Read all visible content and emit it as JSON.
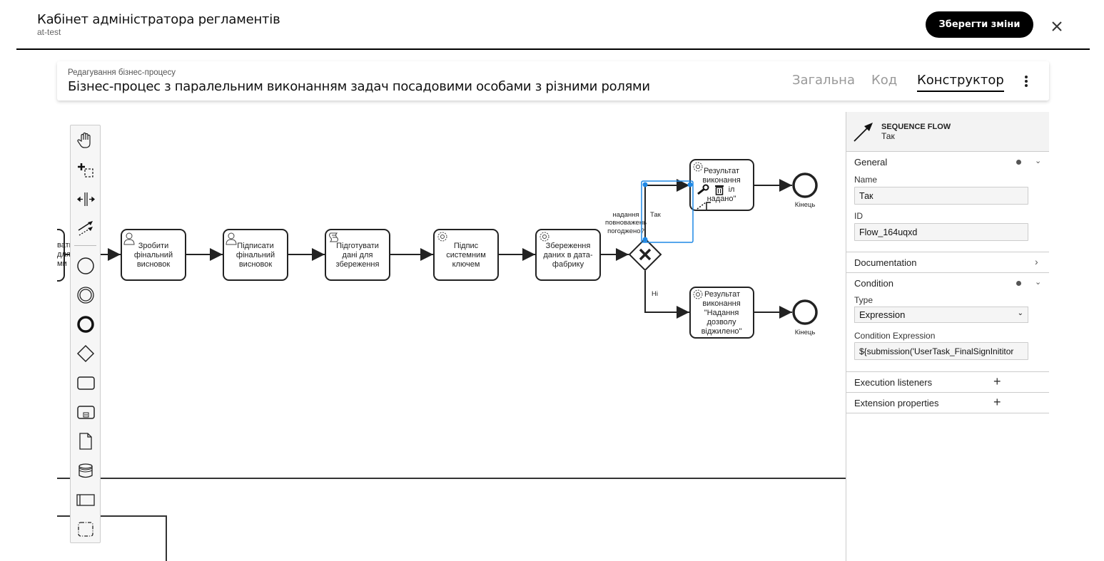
{
  "header": {
    "title": "Кабінет адміністратора регламентів",
    "subtitle": "at-test",
    "save_label": "Зберегти зміни",
    "close_icon": "close-icon"
  },
  "process": {
    "caption": "Редагування бізнес-процесу",
    "title": "Бізнес-процес з паралельним виконанням задач посадовими особами з різними ролями",
    "tabs": [
      {
        "label": "Загальна",
        "active": false
      },
      {
        "label": "Код",
        "active": false
      },
      {
        "label": "Конструктор",
        "active": true
      }
    ],
    "menu_icon": "kebab-menu-icon"
  },
  "palette": {
    "tools": [
      "hand-tool-icon",
      "lasso-tool-icon",
      "space-tool-icon",
      "global-connect-tool-icon"
    ],
    "shapes": [
      "start-event-icon",
      "intermediate-event-icon",
      "end-event-icon",
      "gateway-icon",
      "task-icon",
      "subprocess-icon",
      "data-object-icon",
      "data-store-icon",
      "pool-icon",
      "group-icon"
    ]
  },
  "diagram": {
    "partial_left_text": [
      "вати",
      "для",
      "ми"
    ],
    "tasks": [
      {
        "id": "t1",
        "type": "user",
        "lines": [
          "Зробити",
          "фінальний",
          "висновок"
        ]
      },
      {
        "id": "t2",
        "type": "user",
        "lines": [
          "Підписати",
          "фінальний",
          "висновок"
        ]
      },
      {
        "id": "t3",
        "type": "script",
        "lines": [
          "Підготувати",
          "дані для",
          "збереження"
        ]
      },
      {
        "id": "t4",
        "type": "service",
        "lines": [
          "Підпис",
          "системним",
          "ключем"
        ]
      },
      {
        "id": "t5",
        "type": "service",
        "lines": [
          "Збереження",
          "даних в дата-",
          "фабрику"
        ]
      },
      {
        "id": "t6",
        "type": "service",
        "lines": [
          "Результат",
          "виконання",
          "\"Надання дозволу",
          "надано\""
        ]
      },
      {
        "id": "t7",
        "type": "service",
        "lines": [
          "Результат",
          "виконання",
          "\"Надання",
          "дозволу",
          "віджилено\""
        ]
      }
    ],
    "gateway_label": [
      "надання",
      "повноважень",
      "погоджено?"
    ],
    "flow_yes": "Так",
    "flow_no": "Ні",
    "end_label": "Кінець",
    "selection_color": "#1e88e5"
  },
  "properties": {
    "element_type": "SEQUENCE FLOW",
    "element_name": "Так",
    "groups": {
      "general": "General",
      "documentation": "Documentation",
      "condition": "Condition",
      "execution_listeners": "Execution listeners",
      "extension_properties": "Extension properties"
    },
    "fields": {
      "name_label": "Name",
      "name_value": "Так",
      "id_label": "ID",
      "id_value": "Flow_164uqxd",
      "type_label": "Type",
      "type_value": "Expression",
      "cond_label": "Condition Expression",
      "cond_value": "${submission('UserTask_FinalSignInititor"
    }
  }
}
